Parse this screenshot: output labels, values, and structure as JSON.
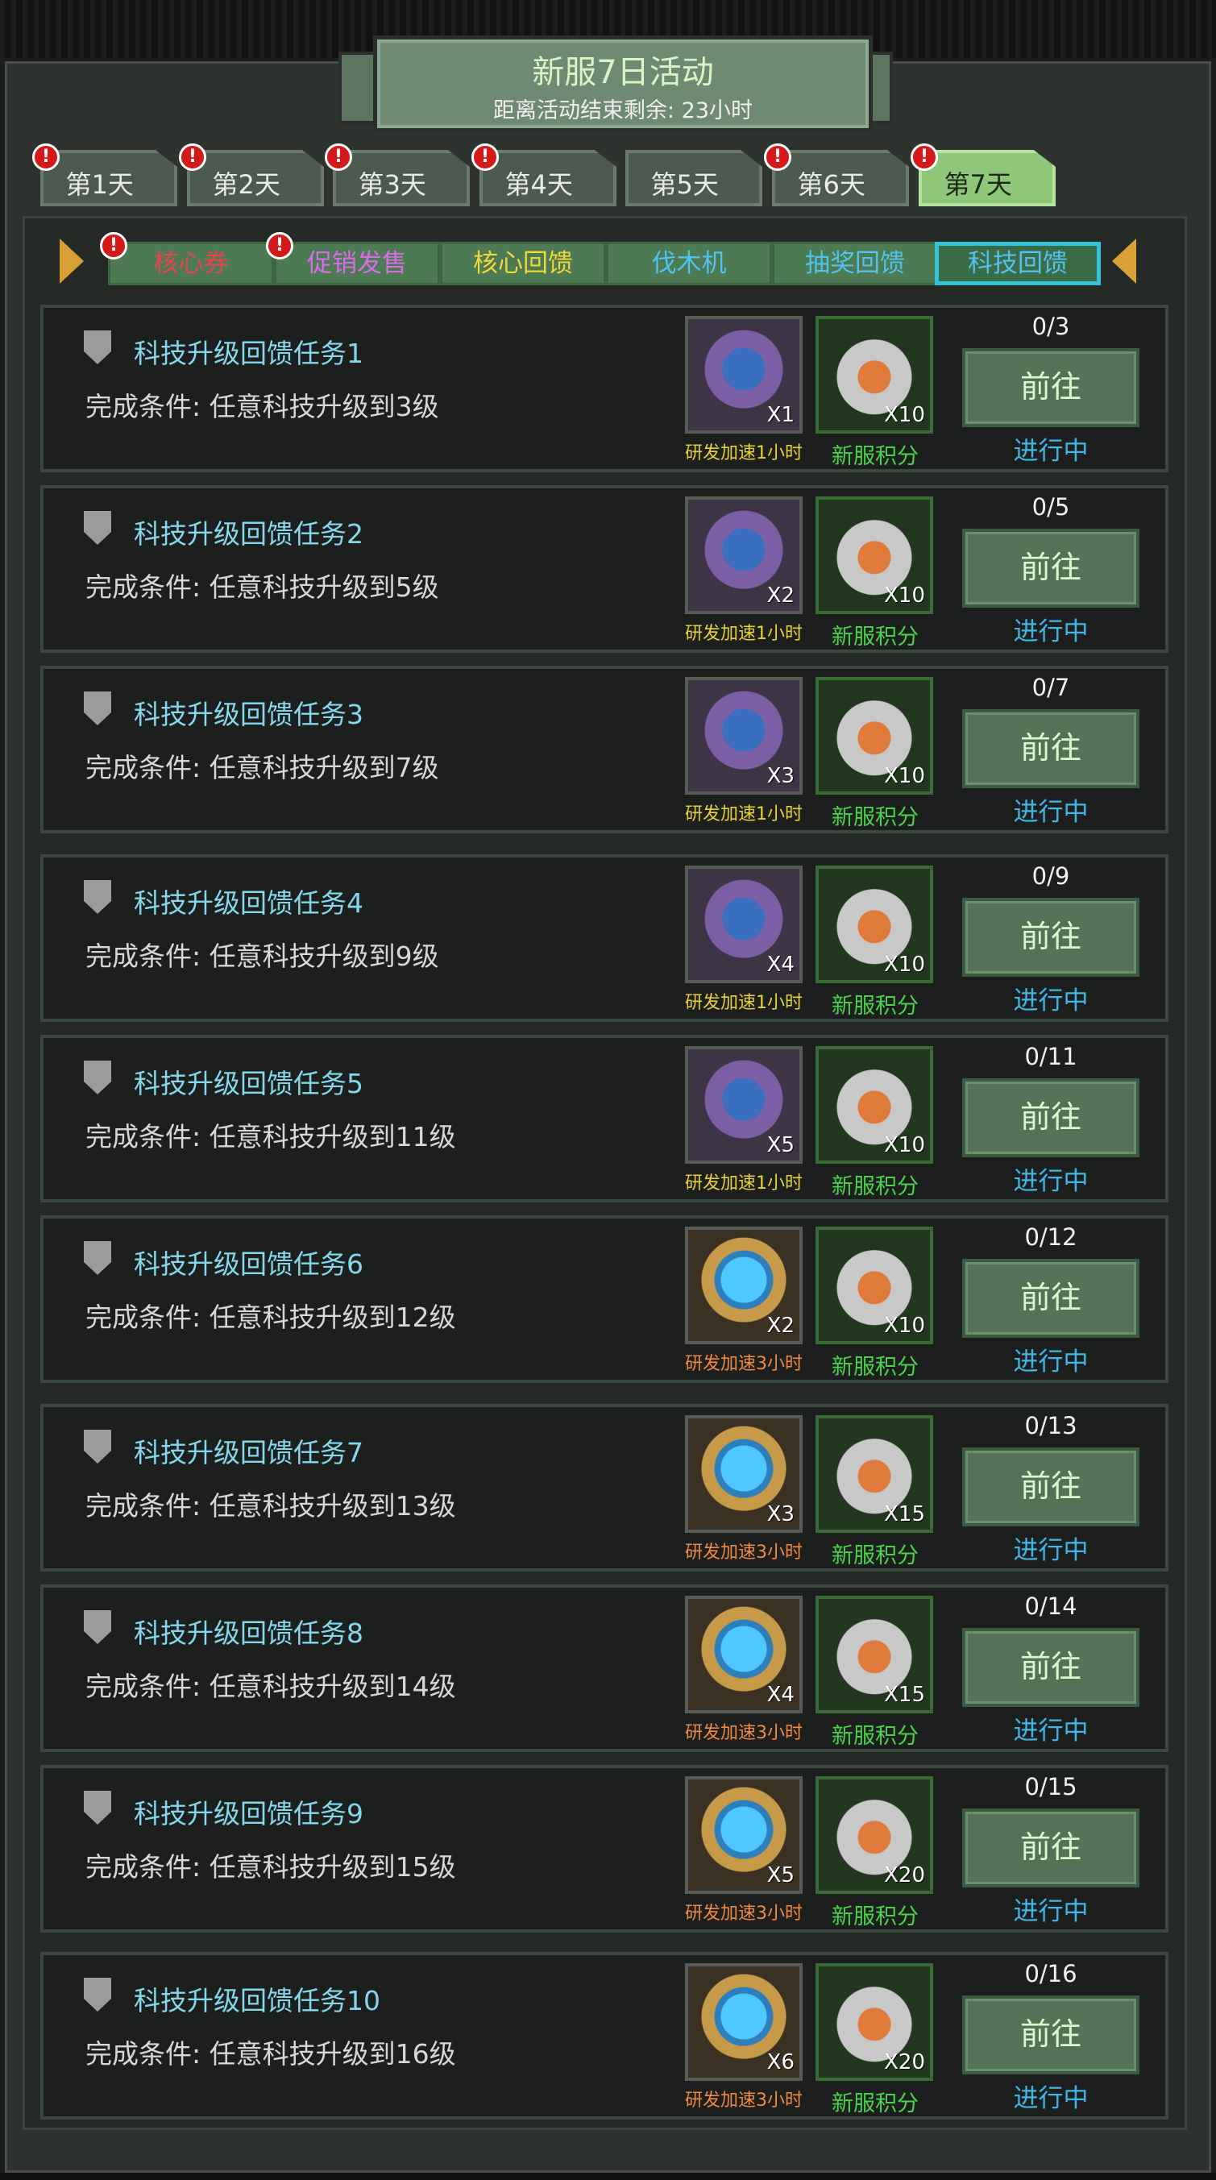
{
  "header": {
    "title": "新服7日活动",
    "subtitle": "距离活动结束剩余: 23小时"
  },
  "days": [
    {
      "label": "第1天",
      "badge": "!",
      "active": false
    },
    {
      "label": "第2天",
      "badge": "!",
      "active": false
    },
    {
      "label": "第3天",
      "badge": "!",
      "active": false
    },
    {
      "label": "第4天",
      "badge": "!",
      "active": false
    },
    {
      "label": "第5天",
      "badge": "",
      "active": false
    },
    {
      "label": "第6天",
      "badge": "!",
      "active": false
    },
    {
      "label": "第7天",
      "badge": "!",
      "active": true
    }
  ],
  "subtabs": [
    {
      "label": "核心券",
      "color": "#e8434c",
      "badge": "!",
      "active": false
    },
    {
      "label": "促销发售",
      "color": "#d96ce8",
      "badge": "!",
      "active": false
    },
    {
      "label": "核心回馈",
      "color": "#f1d83a",
      "badge": "",
      "active": false
    },
    {
      "label": "伐木机",
      "color": "#52c2ee",
      "badge": "",
      "active": false
    },
    {
      "label": "抽奖回馈",
      "color": "#52c2ee",
      "badge": "",
      "active": false
    },
    {
      "label": "科技回馈",
      "color": "#52c2ee",
      "badge": "",
      "active": true
    }
  ],
  "tasks": [
    {
      "title": "科技升级回馈任务1",
      "condition": "完成条件: 任意科技升级到3级",
      "reward1_qty": "X1",
      "reward1_label": "研发加速1小时",
      "reward1_type": "purple",
      "reward1_color": "#e8d233",
      "reward2_qty": "X10",
      "reward2_label": "新服积分",
      "progress": "0/3",
      "button": "前往",
      "status": "进行中"
    },
    {
      "title": "科技升级回馈任务2",
      "condition": "完成条件: 任意科技升级到5级",
      "reward1_qty": "X2",
      "reward1_label": "研发加速1小时",
      "reward1_type": "purple",
      "reward1_color": "#e8d233",
      "reward2_qty": "X10",
      "reward2_label": "新服积分",
      "progress": "0/5",
      "button": "前往",
      "status": "进行中"
    },
    {
      "title": "科技升级回馈任务3",
      "condition": "完成条件: 任意科技升级到7级",
      "reward1_qty": "X3",
      "reward1_label": "研发加速1小时",
      "reward1_type": "purple",
      "reward1_color": "#e8d233",
      "reward2_qty": "X10",
      "reward2_label": "新服积分",
      "progress": "0/7",
      "button": "前往",
      "status": "进行中"
    },
    {
      "title": "科技升级回馈任务4",
      "condition": "完成条件: 任意科技升级到9级",
      "reward1_qty": "X4",
      "reward1_label": "研发加速1小时",
      "reward1_type": "purple",
      "reward1_color": "#e8d233",
      "reward2_qty": "X10",
      "reward2_label": "新服积分",
      "progress": "0/9",
      "button": "前往",
      "status": "进行中"
    },
    {
      "title": "科技升级回馈任务5",
      "condition": "完成条件: 任意科技升级到11级",
      "reward1_qty": "X5",
      "reward1_label": "研发加速1小时",
      "reward1_type": "purple",
      "reward1_color": "#e8d233",
      "reward2_qty": "X10",
      "reward2_label": "新服积分",
      "progress": "0/11",
      "button": "前往",
      "status": "进行中"
    },
    {
      "title": "科技升级回馈任务6",
      "condition": "完成条件: 任意科技升级到12级",
      "reward1_qty": "X2",
      "reward1_label": "研发加速3小时",
      "reward1_type": "gold",
      "reward1_color": "#f08a3c",
      "reward2_qty": "X10",
      "reward2_label": "新服积分",
      "progress": "0/12",
      "button": "前往",
      "status": "进行中"
    },
    {
      "title": "科技升级回馈任务7",
      "condition": "完成条件: 任意科技升级到13级",
      "reward1_qty": "X3",
      "reward1_label": "研发加速3小时",
      "reward1_type": "gold",
      "reward1_color": "#f08a3c",
      "reward2_qty": "X15",
      "reward2_label": "新服积分",
      "progress": "0/13",
      "button": "前往",
      "status": "进行中"
    },
    {
      "title": "科技升级回馈任务8",
      "condition": "完成条件: 任意科技升级到14级",
      "reward1_qty": "X4",
      "reward1_label": "研发加速3小时",
      "reward1_type": "gold",
      "reward1_color": "#f08a3c",
      "reward2_qty": "X15",
      "reward2_label": "新服积分",
      "progress": "0/14",
      "button": "前往",
      "status": "进行中"
    },
    {
      "title": "科技升级回馈任务9",
      "condition": "完成条件: 任意科技升级到15级",
      "reward1_qty": "X5",
      "reward1_label": "研发加速3小时",
      "reward1_type": "gold",
      "reward1_color": "#f08a3c",
      "reward2_qty": "X20",
      "reward2_label": "新服积分",
      "progress": "0/15",
      "button": "前往",
      "status": "进行中"
    },
    {
      "title": "科技升级回馈任务10",
      "condition": "完成条件: 任意科技升级到16级",
      "reward1_qty": "X6",
      "reward1_label": "研发加速3小时",
      "reward1_type": "gold",
      "reward1_color": "#f08a3c",
      "reward2_qty": "X20",
      "reward2_label": "新服积分",
      "progress": "0/16",
      "button": "前往",
      "status": "进行中"
    }
  ]
}
